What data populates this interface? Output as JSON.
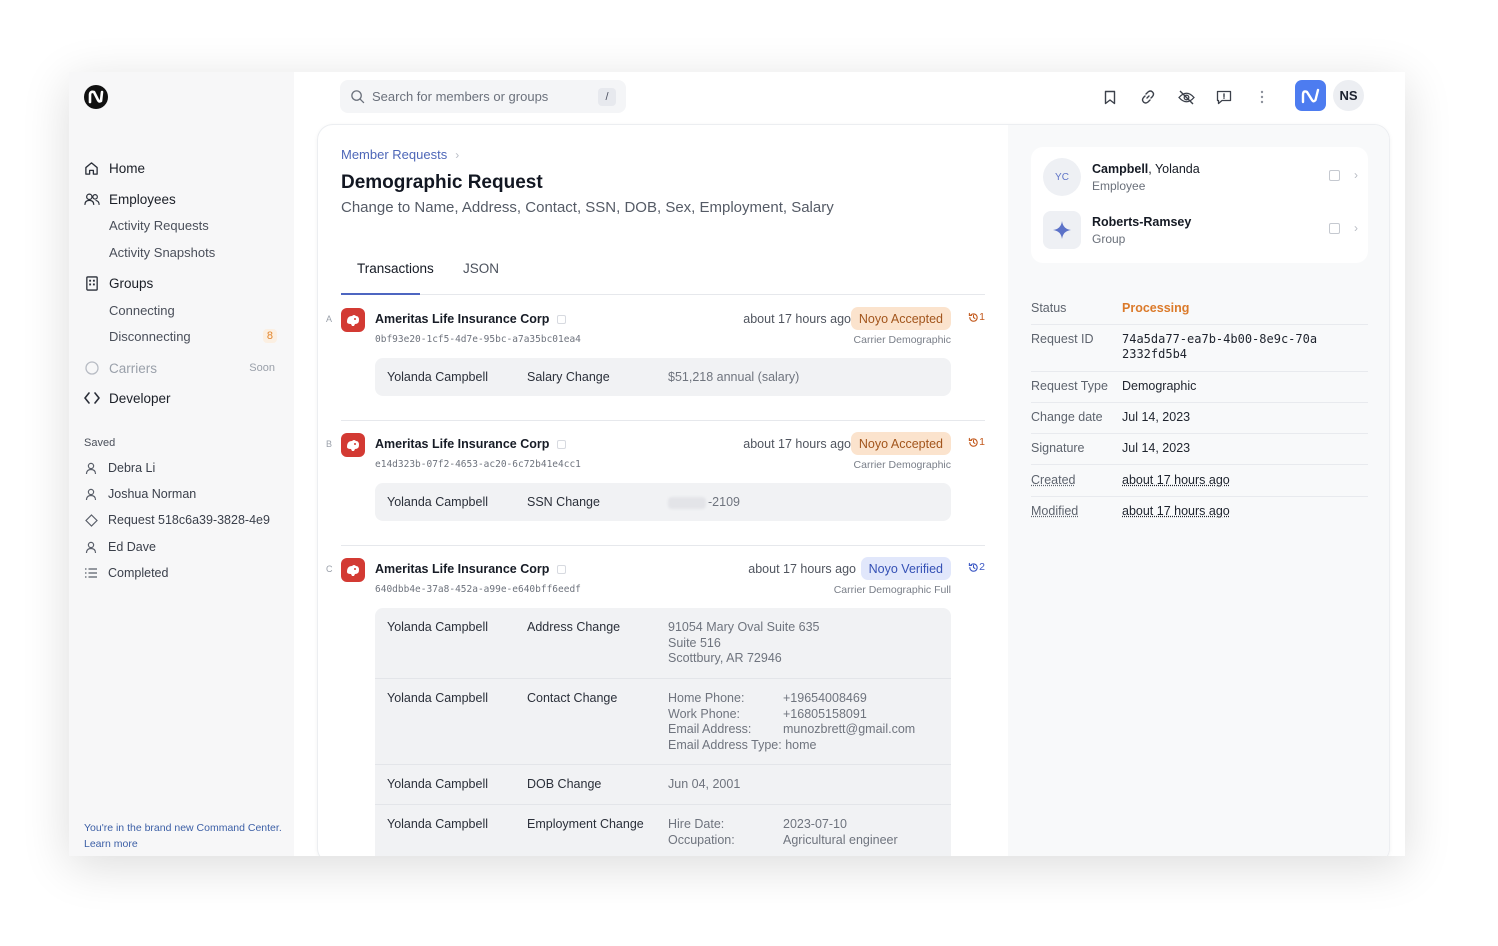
{
  "sidebar": {
    "nav": {
      "home": "Home",
      "employees": "Employees",
      "activity_requests": "Activity Requests",
      "activity_snapshots": "Activity Snapshots",
      "groups": "Groups",
      "connecting": "Connecting",
      "disconnecting": "Disconnecting",
      "disconnecting_count": "8",
      "carriers": "Carriers",
      "carriers_badge": "Soon",
      "developer": "Developer"
    },
    "saved_title": "Saved",
    "saved": [
      {
        "label": "Debra Li",
        "icon": "user-icon"
      },
      {
        "label": "Joshua Norman",
        "icon": "user-icon"
      },
      {
        "label": "Request 518c6a39-3828-4e9",
        "icon": "diamond-icon"
      },
      {
        "label": "Ed Dave",
        "icon": "user-icon"
      },
      {
        "label": "Completed",
        "icon": "list-icon"
      }
    ],
    "footer": "You're in the brand new Command Center. Learn more"
  },
  "topbar": {
    "search_placeholder": "Search for members or groups",
    "search_shortcut": "/",
    "user_initials": "NS"
  },
  "header": {
    "breadcrumb": "Member Requests",
    "title": "Demographic Request",
    "subtitle": "Change to Name, Address, Contact, SSN, DOB, Sex, Employment, Salary"
  },
  "tabs": [
    "Transactions",
    "JSON"
  ],
  "transactions": [
    {
      "letter": "A",
      "carrier": "Ameritas Life Insurance Corp",
      "id": "0bf93e20-1cf5-4d7e-95bc-a7a35bc01ea4",
      "time": "about 17 hours ago",
      "status": "Noyo Accepted",
      "retries": "1",
      "type": "Carrier Demographic",
      "changes": [
        {
          "person": "Yolanda Campbell",
          "kind": "Salary Change",
          "value": "$51,218 annual (salary)"
        }
      ]
    },
    {
      "letter": "B",
      "carrier": "Ameritas Life Insurance Corp",
      "id": "e14d323b-07f2-4653-ac20-6c72b41e4cc1",
      "time": "about 17 hours ago",
      "status": "Noyo Accepted",
      "retries": "1",
      "type": "Carrier Demographic",
      "changes": [
        {
          "person": "Yolanda Campbell",
          "kind": "SSN Change",
          "value": "-2109"
        }
      ]
    },
    {
      "letter": "C",
      "carrier": "Ameritas Life Insurance Corp",
      "id": "640dbb4e-37a8-452a-a99e-e640bff6eedf",
      "time": "about 17 hours ago",
      "status": "Noyo Verified",
      "retries": "2",
      "type": "Carrier Demographic Full",
      "changes": [
        {
          "person": "Yolanda Campbell",
          "kind": "Address Change",
          "lines": [
            "91054 Mary Oval Suite 635",
            "Suite 516",
            "Scottbury, AR 72946"
          ]
        },
        {
          "person": "Yolanda Campbell",
          "kind": "Contact Change",
          "pairs": [
            [
              "Home Phone:",
              "+19654008469"
            ],
            [
              "Work Phone:",
              "+16805158091"
            ],
            [
              "Email Address:",
              "munozbrett@gmail.com"
            ],
            [
              "Email Address Type:",
              "home"
            ]
          ]
        },
        {
          "person": "Yolanda Campbell",
          "kind": "DOB Change",
          "value": "Jun 04, 2001"
        },
        {
          "person": "Yolanda Campbell",
          "kind": "Employment Change",
          "pairs": [
            [
              "Hire Date:",
              "2023-07-10"
            ],
            [
              "Occupation:",
              "Agricultural engineer"
            ]
          ]
        }
      ]
    }
  ],
  "entities": [
    {
      "initials": "YC",
      "last": "Campbell",
      "first": ", Yolanda",
      "role": "Employee"
    },
    {
      "last": "Roberts-Ramsey",
      "first": "",
      "role": "Group"
    }
  ],
  "details": [
    {
      "label": "Status",
      "value": "Processing"
    },
    {
      "label": "Request ID",
      "value": "74a5da77-ea7b-4b00-8e9c-70a2332fd5b4"
    },
    {
      "label": "Request Type",
      "value": "Demographic"
    },
    {
      "label": "Change date",
      "value": "Jul 14, 2023"
    },
    {
      "label": "Signature",
      "value": "Jul 14, 2023"
    },
    {
      "label": "Created",
      "value": "about 17 hours ago"
    },
    {
      "label": "Modified",
      "value": "about 17 hours ago"
    }
  ],
  "colors": {
    "accent": "#4d66c1",
    "brand": "#4d7cf0",
    "processing": "#db7a2a",
    "accepted_bg": "#fbe3cd",
    "verified_bg": "#e1e7fb",
    "carrier_logo": "#d33a33"
  }
}
